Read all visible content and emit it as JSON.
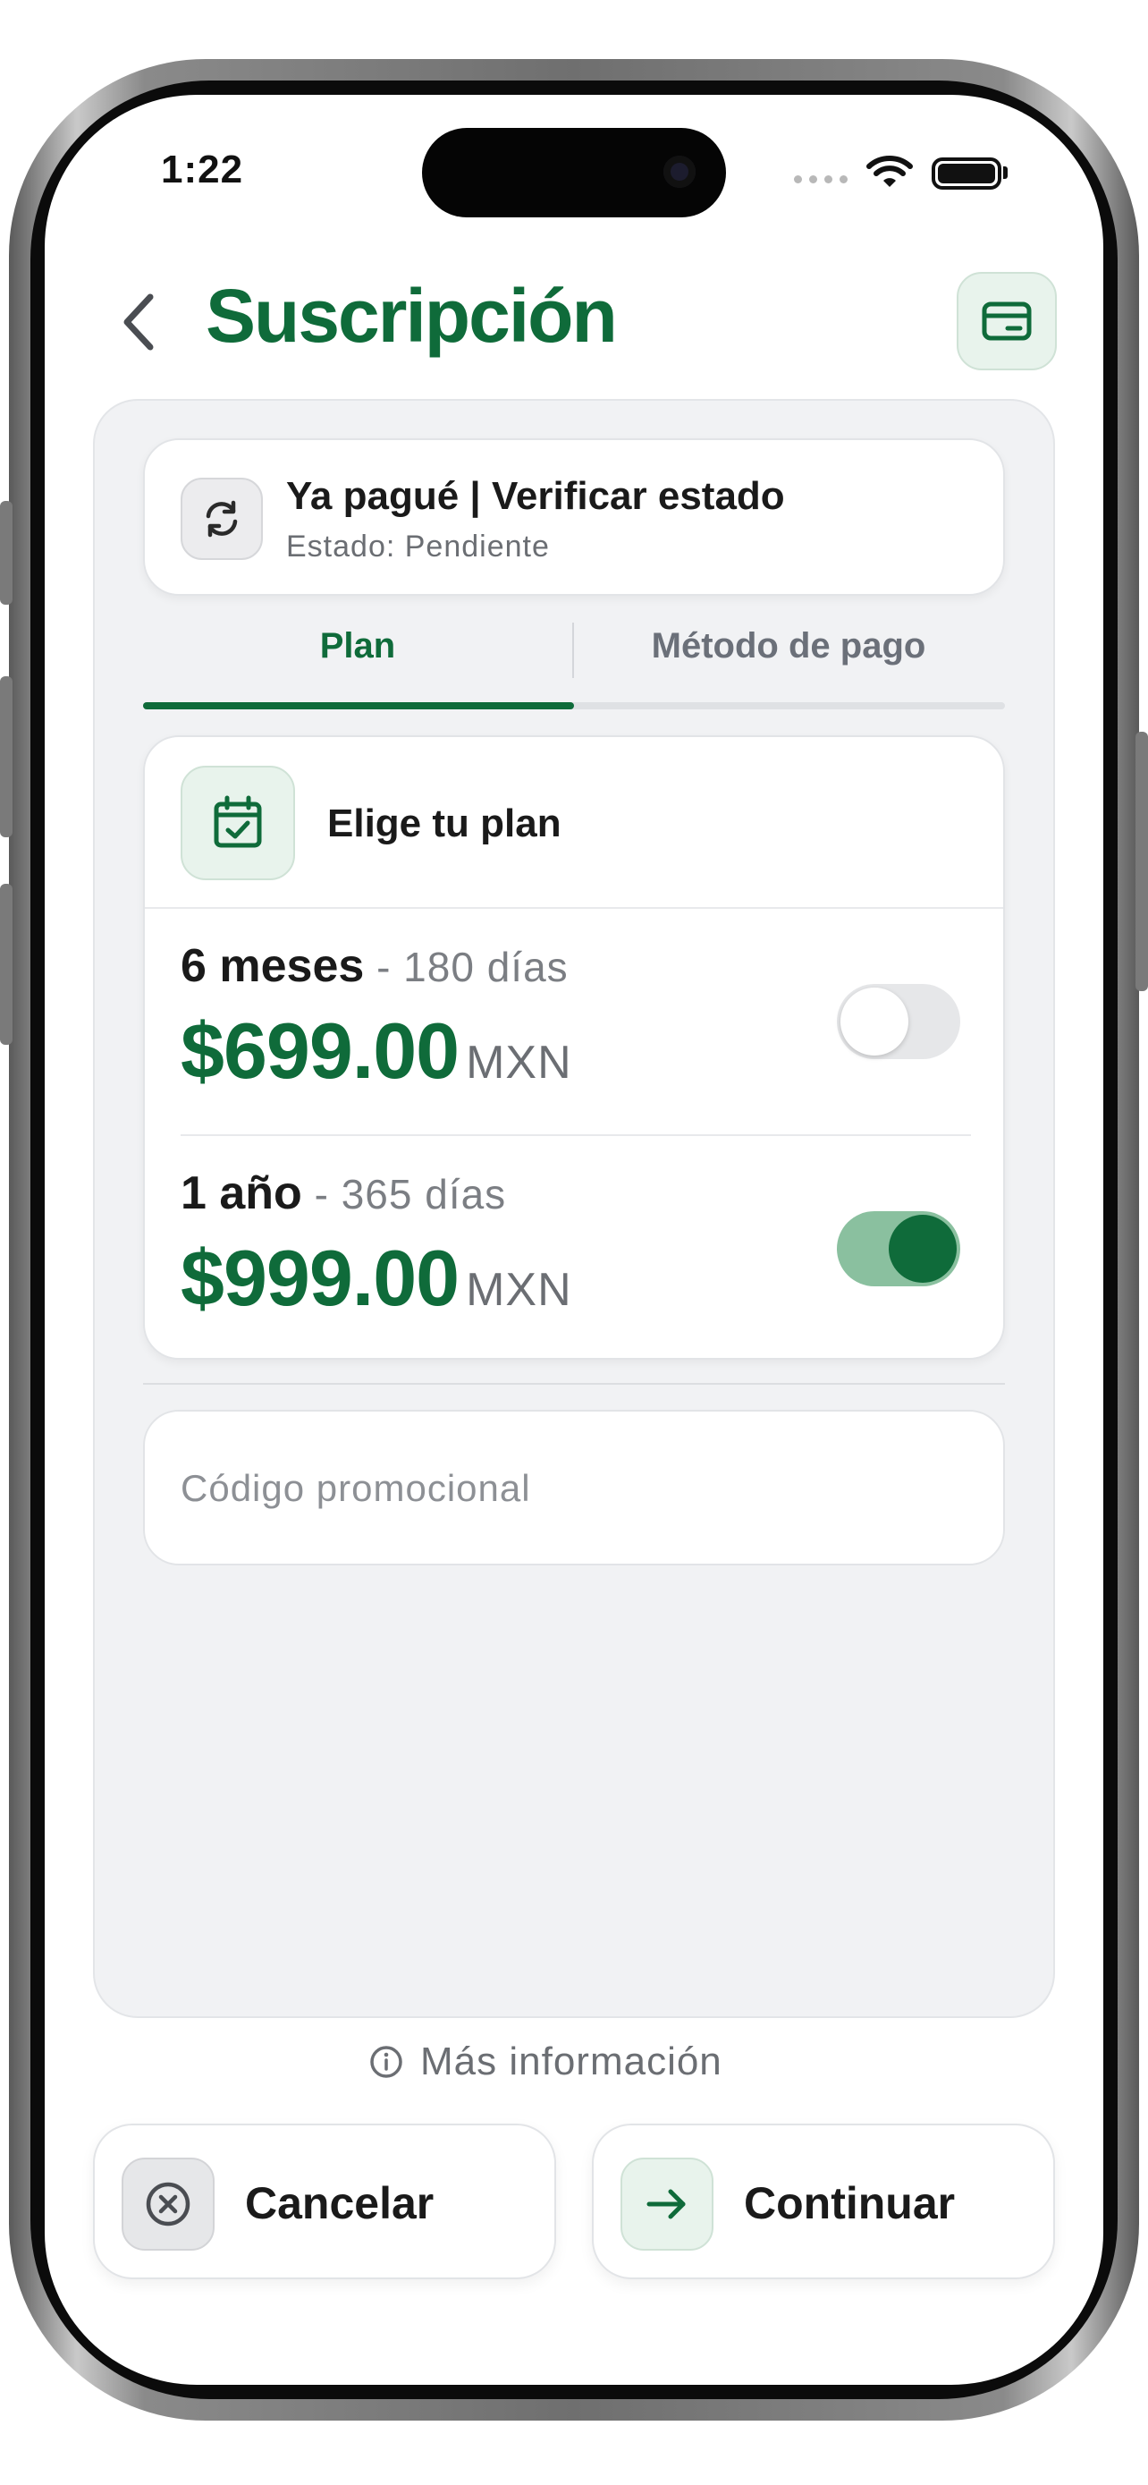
{
  "status_bar": {
    "time": "1:22"
  },
  "header": {
    "title": "Suscripción",
    "back_icon": "chevron-left-icon",
    "action_icon": "credit-card-icon"
  },
  "payment_status": {
    "title": "Ya pagué | Verificar estado",
    "subtitle": "Estado: Pendiente",
    "icon": "refresh-icon"
  },
  "tabs": [
    {
      "label": "Plan",
      "active": true
    },
    {
      "label": "Método de pago",
      "active": false
    }
  ],
  "plan_section": {
    "title": "Elige tu plan",
    "icon": "calendar-check-icon",
    "plans": [
      {
        "name": "6 meses",
        "days": " - 180 días",
        "price": "$699.00",
        "currency": "MXN",
        "selected": false
      },
      {
        "name": "1 año",
        "days": " - 365 días",
        "price": "$999.00",
        "currency": "MXN",
        "selected": true
      }
    ]
  },
  "promo": {
    "placeholder": "Código promocional",
    "value": ""
  },
  "more_info": {
    "label": "Más información",
    "icon": "info-icon"
  },
  "actions": {
    "cancel_label": "Cancelar",
    "cancel_icon": "close-circle-icon",
    "continue_label": "Continuar",
    "continue_icon": "arrow-right-icon"
  },
  "colors": {
    "brand": "#0f6b3a",
    "brand_light": "#e8f3ec",
    "toggle_on_track": "#8ac09f",
    "panel_bg": "#f1f2f4"
  }
}
